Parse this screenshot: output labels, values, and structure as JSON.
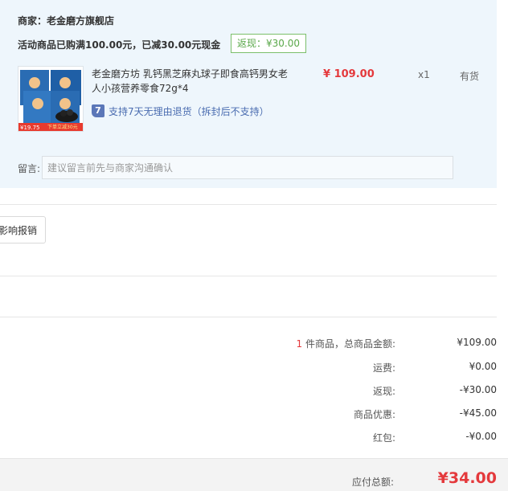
{
  "shop": {
    "merchant": "商家：老金磨方旗舰店",
    "promo": "活动商品已购满100.00元，已减30.00元现金",
    "cashback_badge": "返现：¥30.00"
  },
  "product": {
    "name": "老金磨方坊 乳钙黑芝麻丸球子即食高钙男女老人小孩营养零食72g*4",
    "price": "¥ 109.00",
    "qty": "x1",
    "stock": "有货",
    "return_icon": "7",
    "return_text": "支持7天无理由退货（拆封后不支持）",
    "thumb_price_tag": "¥19.75",
    "thumb_caption": "下单立减30元"
  },
  "message": {
    "label": "留言:",
    "placeholder": "建议留言前先与商家沟通确认"
  },
  "report_button": "影响报销",
  "summary": {
    "count": "1",
    "rows": [
      {
        "label": "件商品，总商品金额:",
        "value": "¥109.00"
      },
      {
        "label": "运费:",
        "value": "¥0.00"
      },
      {
        "label": "返现:",
        "value": "-¥30.00"
      },
      {
        "label": "商品优惠:",
        "value": "-¥45.00"
      },
      {
        "label": "红包:",
        "value": "-¥0.00"
      }
    ]
  },
  "total": {
    "label": "应付总额:",
    "value": "¥34.00"
  },
  "colors": {
    "panel_bg": "#eef6fc",
    "price_red": "#e4393c",
    "badge_green": "#5aa84a",
    "link_blue": "#4a6cb0"
  }
}
